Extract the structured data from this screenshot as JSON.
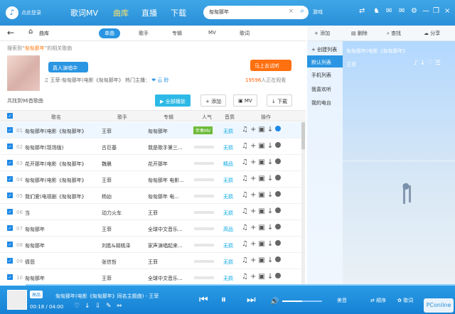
{
  "topbar": {
    "logo_glyph": "♪",
    "logo_text": "点此登录",
    "nav_items": [
      "歌词MV",
      "曲库",
      "直播",
      "下载"
    ],
    "active_nav": "曲库",
    "search_value": "匆匆那年",
    "clear_icon": "×",
    "search_icon": "⌕",
    "user_label": "游戏",
    "icons": [
      "⇄",
      "♞",
      "✉",
      "✉",
      "⚙",
      "—",
      "❐",
      "×"
    ]
  },
  "subnav": {
    "back_icon": "←",
    "home_icon": "⌂",
    "breadcrumb": "曲库",
    "tabs": [
      "单曲",
      "歌手",
      "专辑",
      "MV",
      "歌词"
    ],
    "active_tab": "单曲"
  },
  "search_result": {
    "prefix": "搜索到“",
    "keyword": "匆匆那年",
    "suffix": "”的相关歌曲",
    "artist_name": "王菲",
    "live_badge": "真人演唱中",
    "music_glyph": "♫",
    "info_line": "王菲-匆匆那年(电影《匆匆那年》 热门主播： ",
    "hot_artist": "❤ 云 聆",
    "listen_button": "马上去试听",
    "watching_count": "19596",
    "watching_suffix": "人正在观看"
  },
  "list": {
    "count_text": "共找到96首歌曲",
    "buttons": [
      {
        "icon": "▶",
        "label": "全部播放"
      },
      {
        "icon": "+",
        "label": "添加"
      },
      {
        "icon": "▣",
        "label": "MV"
      },
      {
        "icon": "↓",
        "label": "下载"
      }
    ],
    "headers": [
      "歌名",
      "歌手",
      "专辑",
      "人气",
      "音质",
      "操作"
    ]
  },
  "rows": [
    {
      "num": "01",
      "song": "匆匆那年(电影《匆匆那年》",
      "artist": "王菲",
      "album": "匆匆那年",
      "quality": "无损",
      "tag": "伴奏MV"
    },
    {
      "num": "02",
      "song": "匆匆那年(现场版)",
      "artist": "古巨基",
      "album": "我是歌手第三...",
      "quality": "无损",
      "tag": ""
    },
    {
      "num": "03",
      "song": "花开那年(电影《匆匆那年》",
      "artist": "魏晨",
      "album": "花开那年",
      "quality": "精品",
      "tag": ""
    },
    {
      "num": "04",
      "song": "匆匆那年(电影《匆匆那年》",
      "artist": "王菲",
      "album": "匆匆那年 电影...",
      "quality": "无损",
      "tag": ""
    },
    {
      "num": "05",
      "song": "我们爱(电视剧《匆匆那年》",
      "artist": "杨幼",
      "album": "匆匆那年 电...",
      "quality": "无损",
      "tag": ""
    },
    {
      "num": "06",
      "song": "当",
      "artist": "动力火车",
      "album": "王菲",
      "quality": "无损",
      "tag": ""
    },
    {
      "num": "07",
      "song": "匆匆那年",
      "artist": "王菲",
      "album": "全球中文音乐...",
      "quality": "高品",
      "tag": ""
    },
    {
      "num": "08",
      "song": "匆匆那年",
      "artist": "刘胜&胡桃泽",
      "album": "家声演唱起来...",
      "quality": "无损",
      "tag": ""
    },
    {
      "num": "09",
      "song": "倩怨",
      "artist": "张信哲",
      "album": "王菲",
      "quality": "无损",
      "tag": ""
    },
    {
      "num": "10",
      "song": "匆匆那年",
      "artist": "王菲",
      "album": "全球中文音乐...",
      "quality": "无损",
      "tag": ""
    }
  ],
  "right": {
    "toolbar": [
      "添加",
      "删除",
      "查找",
      "分享"
    ],
    "toolbar_icons": [
      "+",
      "▤",
      "⌕",
      "☁"
    ],
    "sidebar_items": [
      "+ 创建列表",
      "默认列表",
      "手机列表",
      "我喜欢听",
      "我的电台"
    ],
    "now_title": "匆匆那年(电影《匆匆那年》",
    "now_artist": "王菲",
    "now_ops": "♪ ↓ ♡ ☰"
  },
  "player": {
    "mode": "高品",
    "track": "匆匆那年(电影《匆匆那年》同名主题曲) - 王菲",
    "time": "00:18 / 04:00",
    "bottom_icons": [
      "♡",
      "↓",
      "⇩",
      "✎",
      "⇔"
    ],
    "controls": [
      "⏮",
      "⏸",
      "⏭"
    ],
    "volume_icon": "🔊",
    "beauty": "美音",
    "right_controls": [
      "⇄ 顺序",
      "✿ 歌词"
    ],
    "watermark": "PConline"
  }
}
